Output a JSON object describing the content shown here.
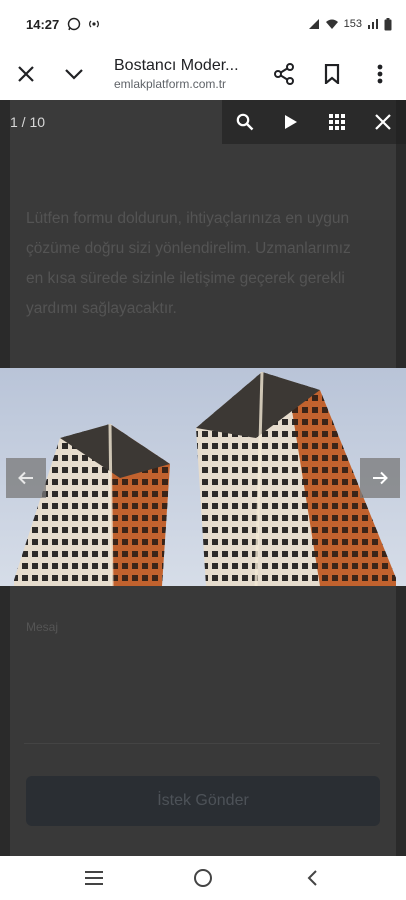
{
  "status": {
    "time": "14:27",
    "right_text": "153"
  },
  "app_bar": {
    "title": "Bostancı Moder...",
    "url": "emlakplatform.com.tr"
  },
  "viewer": {
    "counter": "1 / 10"
  },
  "page": {
    "form_text": "Lütfen formu doldurun, ihtiyaçlarınıza en uygun çözüme doğru sizi yönlendirelim. Uzmanlarımız en kısa sürede sizinle iletişime geçerek gerekli yardımı sağlayacaktır.",
    "message_label": "Mesaj",
    "send_label": "İstek Gönder"
  },
  "colors": {
    "overlay": "#2a2a2a",
    "sky": "#c4cfe0",
    "facade_light": "#e6dccd",
    "facade_orange": "#c1622e"
  }
}
